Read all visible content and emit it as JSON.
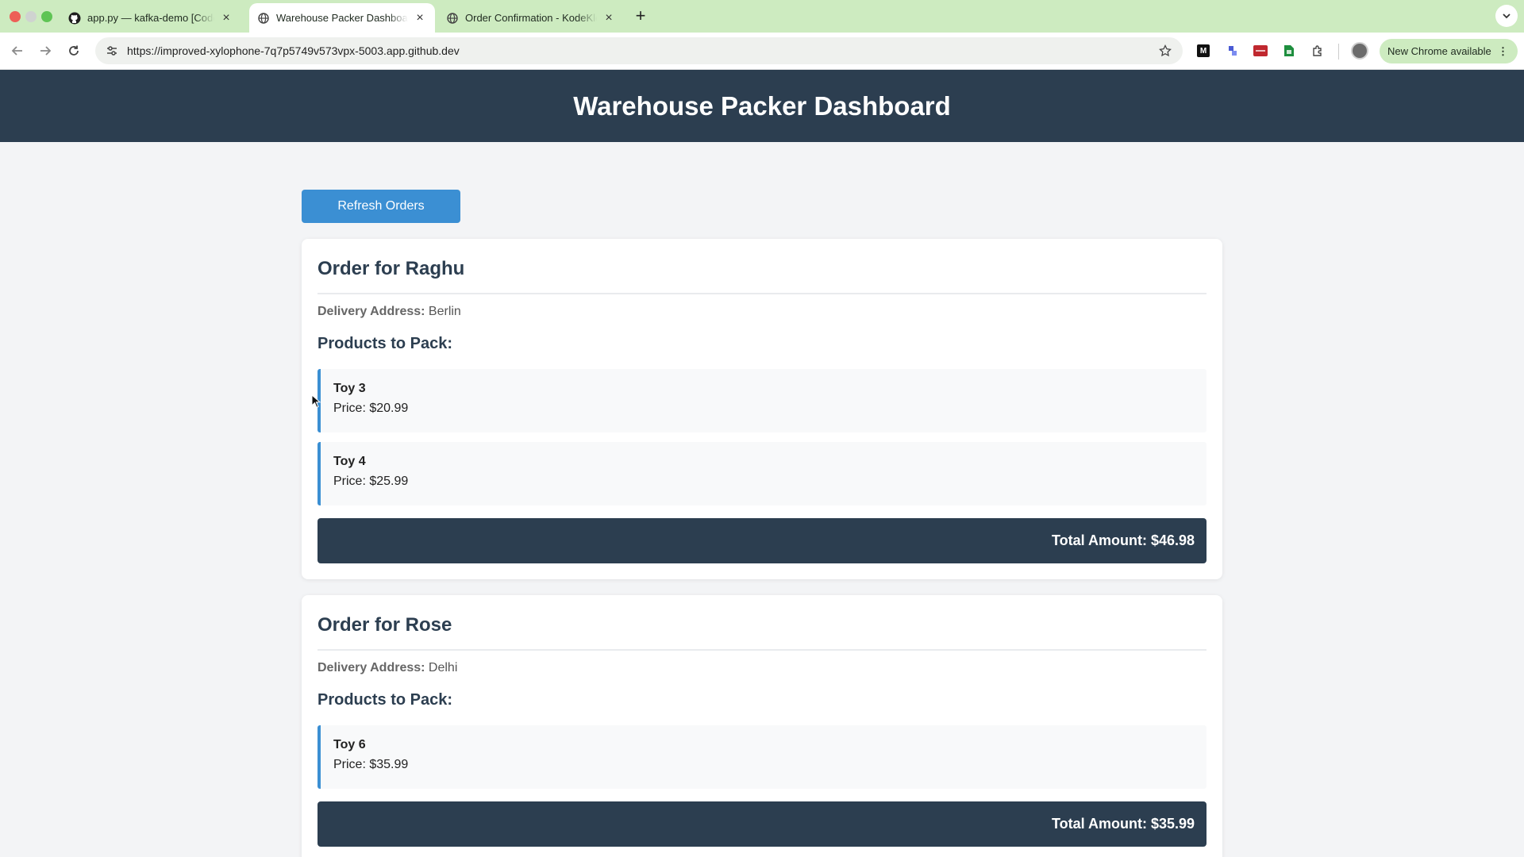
{
  "browser": {
    "tabs": [
      {
        "title": "app.py — kafka-demo [Codespaces]",
        "favicon": "github-icon",
        "active": false
      },
      {
        "title": "Warehouse Packer Dashboard",
        "favicon": "globe-icon",
        "active": true
      },
      {
        "title": "Order Confirmation - KodeKloud",
        "favicon": "globe-icon",
        "active": false
      }
    ],
    "close_glyph": "×",
    "new_tab_glyph": "+",
    "url": "https://improved-xylophone-7q7p5749v573vpx-5003.app.github.dev",
    "update_label": "New Chrome available",
    "update_menu_glyph": "⋮",
    "extensions": [
      {
        "name": "medium-extension-icon",
        "glyph": "M",
        "color": "#111111"
      },
      {
        "name": "puzzle-blue-extension-icon",
        "glyph": "",
        "color": "#4a5bd4"
      },
      {
        "name": "red-extension-icon",
        "glyph": "",
        "color": "#c0282f"
      },
      {
        "name": "green-extension-icon",
        "glyph": "",
        "color": "#1e8e3e"
      },
      {
        "name": "extensions-puzzle-icon",
        "glyph": "",
        "color": "#444444"
      }
    ]
  },
  "page": {
    "title": "Warehouse Packer Dashboard",
    "refresh_label": "Refresh Orders",
    "delivery_label": "Delivery Address:",
    "products_heading": "Products to Pack:",
    "orders": [
      {
        "heading": "Order for Raghu",
        "address": "Berlin",
        "products": [
          {
            "name": "Toy 3",
            "price": "Price: $20.99"
          },
          {
            "name": "Toy 4",
            "price": "Price: $25.99"
          }
        ],
        "total": "Total Amount: $46.98"
      },
      {
        "heading": "Order for Rose",
        "address": "Delhi",
        "products": [
          {
            "name": "Toy 6",
            "price": "Price: $35.99"
          }
        ],
        "total": "Total Amount: $35.99"
      }
    ]
  },
  "colors": {
    "header_bg": "#2c3e50",
    "accent_blue": "#3b8fd3",
    "page_bg": "#f3f4f6",
    "tabstrip_bg": "#cdebc0"
  }
}
